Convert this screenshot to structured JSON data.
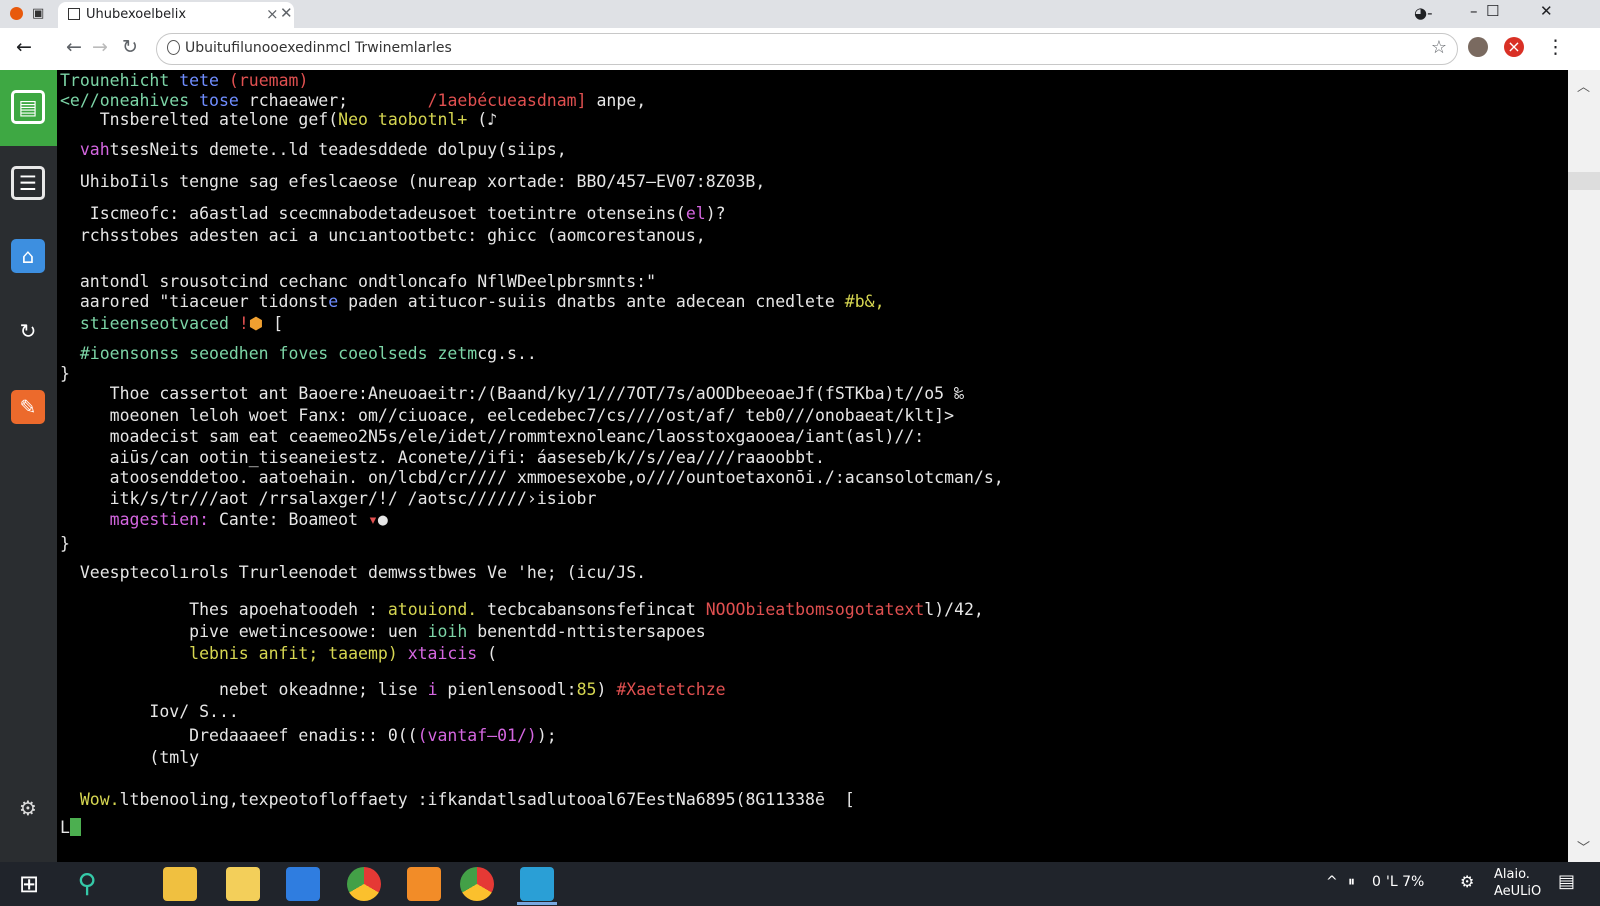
{
  "browser": {
    "tab_title": "Uhubexoelbelix",
    "tab_close": "×",
    "new_tab_close": "✕",
    "url": "Ubuitufilunooexedinmcl Trwinemlarles",
    "min_label": "–",
    "max_label": "☐",
    "close_label": "✕",
    "back_label": "←",
    "forward_label": "→",
    "reload_label": "↻",
    "menu_label": "⋮",
    "star_label": "☆",
    "close_ext_label": "×",
    "window_back_label": "←"
  },
  "colors": {
    "terminal_bg": "#000000",
    "sidebar_bg": "#2a2d30",
    "taskbar_bg": "#20242b",
    "accent_green": "#4caf50",
    "accent_red": "#e53935"
  },
  "terminal": {
    "lines": [
      {
        "segments": [
          {
            "t": "Trounehicht ",
            "c": "#7cd4a6"
          },
          {
            "t": "tete",
            "c": "#6f8dff"
          },
          {
            "t": " (ruemam)",
            "c": "#e05050"
          }
        ]
      },
      {
        "segments": [
          {
            "t": "<e//oneahives ",
            "c": "#7cd4a6"
          },
          {
            "t": "tose",
            "c": "#6f8dff"
          },
          {
            "t": " rchaeawer;        ",
            "c": "#e6e6e6"
          },
          {
            "t": "/1aebécueasdnam]",
            "c": "#e05050"
          },
          {
            "t": " anpe,",
            "c": "#e6e6e6"
          }
        ]
      },
      {
        "segments": [
          {
            "t": "    Tnsberelted atelone gef(",
            "c": "#e6e6e6"
          },
          {
            "t": "Neo",
            "c": "#d6d651"
          },
          {
            "t": " ",
            "c": "#e6e6e6"
          },
          {
            "t": "taobotnl+",
            "c": "#d6d651"
          },
          {
            "t": " (",
            "c": "#e6e6e6"
          },
          {
            "t": "♪",
            "c": "#e6e6e6"
          }
        ]
      },
      {
        "segments": [
          {
            "t": "  vah",
            "c": "#d466e0"
          },
          {
            "t": "tsesNeits demete..ld teadesddede dolpuy(siips,",
            "c": "#e6e6e6"
          }
        ]
      },
      {
        "segments": [
          {
            "t": "  UhiboIils tengne sag efeslcaeose (nureap xortade: BBO/457—EV07:8Z03B,",
            "c": "#e6e6e6"
          }
        ]
      },
      {
        "segments": [
          {
            "t": "   Iscmeofc: a6astlad scecmnabodetadeusoet toetintre otenseins(",
            "c": "#e6e6e6"
          },
          {
            "t": "el",
            "c": "#d466e0"
          },
          {
            "t": ")?",
            "c": "#e6e6e6"
          }
        ]
      },
      {
        "segments": [
          {
            "t": "  rchsstobes adesten aci a uncıantootbetc: ghicc (aomcorestanous,",
            "c": "#e6e6e6"
          }
        ]
      },
      {
        "segments": [
          {
            "t": "  antondl srousotcind cechanc ondtloncafo NflWDeelpbrsmnts:\"",
            "c": "#e6e6e6"
          }
        ]
      },
      {
        "segments": [
          {
            "t": "  aarored \"tiaceuer tidonst",
            "c": "#e6e6e6"
          },
          {
            "t": "e",
            "c": "#6f8dff"
          },
          {
            "t": " paden atitucor-suiis dnatbs ante adecean cnedl",
            "c": "#e6e6e6"
          },
          {
            "t": "ete",
            "c": "#e6e6e6"
          },
          {
            "t": " #b&,",
            "c": "#d6d651"
          }
        ]
      },
      {
        "segments": [
          {
            "t": "  stieenseotvaced ",
            "c": "#7cd4a6"
          },
          {
            "t": "!",
            "c": "#e05050"
          },
          {
            "t": "⬢",
            "c": "#f0a030"
          },
          {
            "t": " [",
            "c": "#e6e6e6"
          }
        ]
      },
      {
        "segments": [
          {
            "t": "  #ioensonss seoedhen foves coeolseds zetm",
            "c": "#7cd4a6"
          },
          {
            "t": "cg.s..",
            "c": "#e6e6e6"
          }
        ]
      },
      {
        "segments": [
          {
            "t": "}",
            "c": "#e6e6e6"
          }
        ]
      },
      {
        "segments": [
          {
            "t": "     Thoe cassertot ant Baoere:Aneuoaeitr:/(Baand/ky/1///7OT/7s/aOODbeeoaeJf(fSTKba)t//o5 ‰",
            "c": "#e6e6e6"
          }
        ]
      },
      {
        "segments": [
          {
            "t": "     moeonen leloh woet Fanx: om//ciuoace, eelcedebec7/cs////ost/af/ teb0///onobaeat/klt]>",
            "c": "#e6e6e6"
          }
        ]
      },
      {
        "segments": [
          {
            "t": "     moadecist sam eat ceaemeo2N5s/ele/idet//rommtexnoleanc/laosstoxgaooea/iant(asl)//:",
            "c": "#e6e6e6"
          }
        ]
      },
      {
        "segments": [
          {
            "t": "     aiūs/can ootin_tiseaneiestz. Aconete//ifi: áaseseb/k//s//ea////raaoobbt.",
            "c": "#e6e6e6"
          }
        ]
      },
      {
        "segments": [
          {
            "t": "     atoosenddetoo. aatoehain. on/lcbd/cr//// xmmoesexobe,o////ountoetaxonōi./:acansolotcman/s,",
            "c": "#e6e6e6"
          }
        ]
      },
      {
        "segments": [
          {
            "t": "     itk/s/tr///aot /rrsalaxger/!/ /aotsc//////›isiobr",
            "c": "#e6e6e6"
          }
        ]
      },
      {
        "segments": [
          {
            "t": "     magestien:",
            "c": "#d466e0"
          },
          {
            "t": " Cante: Boameot ",
            "c": "#e6e6e6"
          },
          {
            "t": "▾",
            "c": "#e05050"
          },
          {
            "t": "●",
            "c": "#e6e6e6"
          }
        ]
      },
      {
        "segments": [
          {
            "t": "}",
            "c": "#e6e6e6"
          }
        ]
      },
      {
        "segments": [
          {
            "t": "  Veesptecolırols Trurleenodet demwsstbwes Ve 'he; (icu/JS.",
            "c": "#e6e6e6"
          }
        ]
      },
      {
        "segments": [
          {
            "t": "             Thes apoehatoodeh : ",
            "c": "#e6e6e6"
          },
          {
            "t": "atouiond.",
            "c": "#d6d651"
          },
          {
            "t": " tecbcabansonsfefincat ",
            "c": "#e6e6e6"
          },
          {
            "t": "NOOObieatbomsogotatext",
            "c": "#e05050"
          },
          {
            "t": "l)/42,",
            "c": "#e6e6e6"
          }
        ]
      },
      {
        "segments": [
          {
            "t": "             pive ewetincesoowe: uen ",
            "c": "#e6e6e6"
          },
          {
            "t": "ioih",
            "c": "#7cd4a6"
          },
          {
            "t": " benentdd-nttistersapoes",
            "c": "#e6e6e6"
          }
        ]
      },
      {
        "segments": [
          {
            "t": "             lebnis anfit; taaemp) ",
            "c": "#d6d651"
          },
          {
            "t": "xtaicis",
            "c": "#d466e0"
          },
          {
            "t": " (",
            "c": "#e6e6e6"
          }
        ]
      },
      {
        "segments": [
          {
            "t": "                nebet okeadnne; lise ",
            "c": "#e6e6e6"
          },
          {
            "t": "i",
            "c": "#d466e0"
          },
          {
            "t": " pienlensoodl:",
            "c": "#e6e6e6"
          },
          {
            "t": "85",
            "c": "#d6d651"
          },
          {
            "t": ") ",
            "c": "#e6e6e6"
          },
          {
            "t": "#Xaetetchze",
            "c": "#e05050"
          }
        ]
      },
      {
        "segments": [
          {
            "t": "         Iov/ S...",
            "c": "#e6e6e6"
          }
        ]
      },
      {
        "segments": [
          {
            "t": "             Dredaaaeef enadis:: 0((",
            "c": "#e6e6e6"
          },
          {
            "t": "(vantaf—01/)",
            "c": "#d466e0"
          },
          {
            "t": ");",
            "c": "#e6e6e6"
          }
        ]
      },
      {
        "segments": [
          {
            "t": "         (tmly",
            "c": "#e6e6e6"
          }
        ]
      },
      {
        "segments": [
          {
            "t": "  Wow.",
            "c": "#d6d651"
          },
          {
            "t": "ltbenooling,texpeotofloffaety :ifkandatlsadlutooal67EestNa6895(8G11338ē  [",
            "c": "#e6e6e6"
          }
        ]
      }
    ],
    "prompt": "L"
  },
  "taskbar": {
    "tray_arrow": "^",
    "tray_mic": "⏸",
    "tray_battery": "0",
    "tray_percent": "'L 7%",
    "time": "Alaio.",
    "date": "AeULiO",
    "notif": "▤"
  },
  "sidebar": {
    "items": [
      "document-app",
      "news-app",
      "home-app",
      "sync-app",
      "edit-app"
    ]
  }
}
